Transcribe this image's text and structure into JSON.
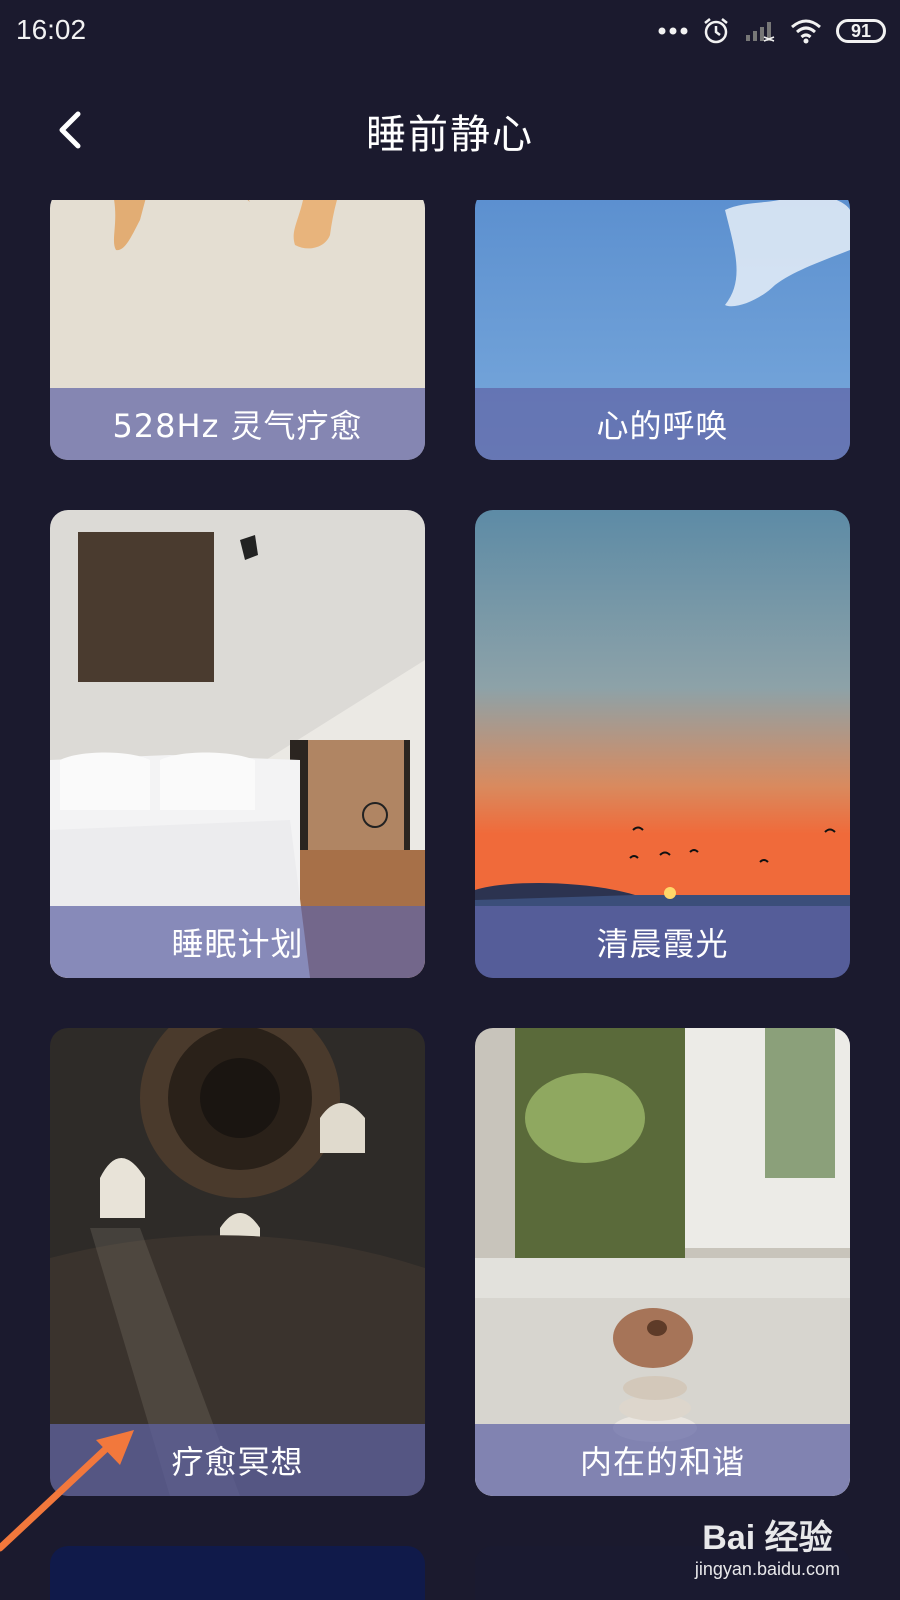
{
  "status": {
    "time": "16:02",
    "battery": "91"
  },
  "header": {
    "title": "睡前静心"
  },
  "cards": [
    {
      "label": "528Hz 灵气疗愈"
    },
    {
      "label": "心的呼唤"
    },
    {
      "label": "睡眠计划"
    },
    {
      "label": "清晨霞光"
    },
    {
      "label": "疗愈冥想"
    },
    {
      "label": "内在的和谐"
    }
  ],
  "watermark": {
    "brand": "Bai 经验",
    "url": "jingyan.baidu.com"
  },
  "colors": {
    "background": "#1b1a2e",
    "label_overlay": "#5f64a5",
    "arrow": "#f2783c"
  }
}
